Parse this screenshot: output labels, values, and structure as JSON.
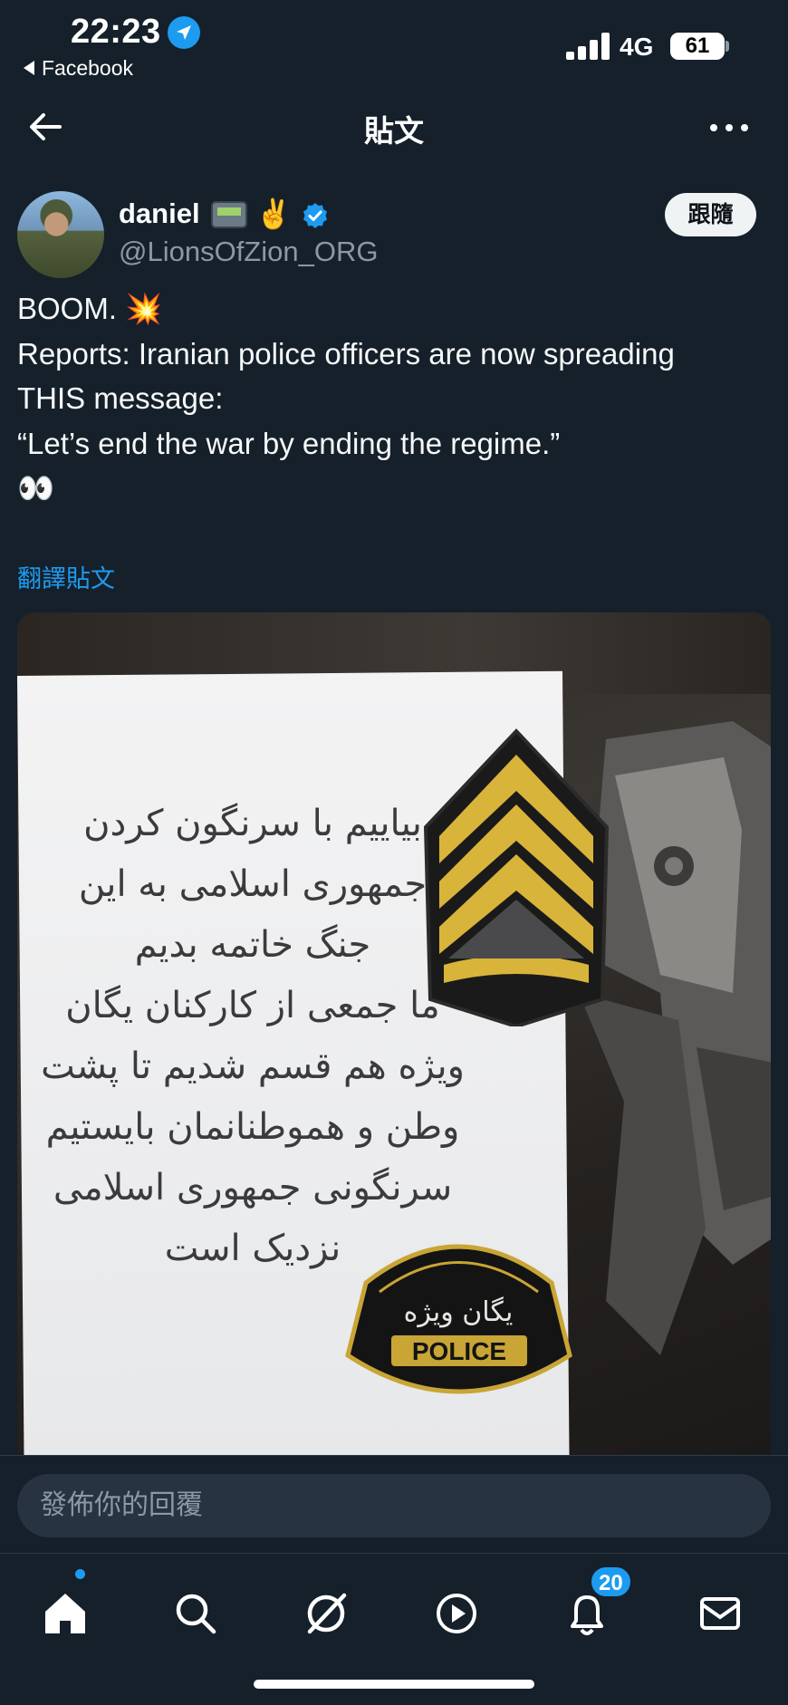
{
  "status_bar": {
    "time": "22:23",
    "back_app": "Facebook",
    "network": "4G",
    "battery": "61"
  },
  "header": {
    "title": "貼文"
  },
  "author": {
    "display_name": "daniel",
    "emojis": [
      "📟",
      "✌️"
    ],
    "handle": "@LionsOfZion_ORG",
    "follow_label": "跟隨"
  },
  "tweet": {
    "lines": [
      "BOOM. 💥",
      "Reports: Iranian police officers are now spreading",
      "THIS message:",
      "“Let’s end the war by ending the regime.”",
      "👀"
    ],
    "translate_label": "翻譯貼文"
  },
  "media": {
    "note_lines": [
      "بیاییم با سرنگون کردن",
      "جمهوری اسلامی به این",
      "جنگ خاتمه بدیم",
      "ما جمعی از کارکنان یگان",
      "ویژه هم قسم شدیم تا پشت",
      "وطن و هموطنانمان بایستیم",
      "سرنگونی جمهوری اسلامی",
      "نزدیک است"
    ],
    "patch_text": "یگان ویژه",
    "patch_label": "POLICE"
  },
  "reply": {
    "placeholder": "發佈你的回覆"
  },
  "nav": {
    "notifications_count": "20"
  },
  "colors": {
    "background": "#15202b",
    "accent": "#1d9bf0",
    "secondary_text": "#8b98a5"
  }
}
